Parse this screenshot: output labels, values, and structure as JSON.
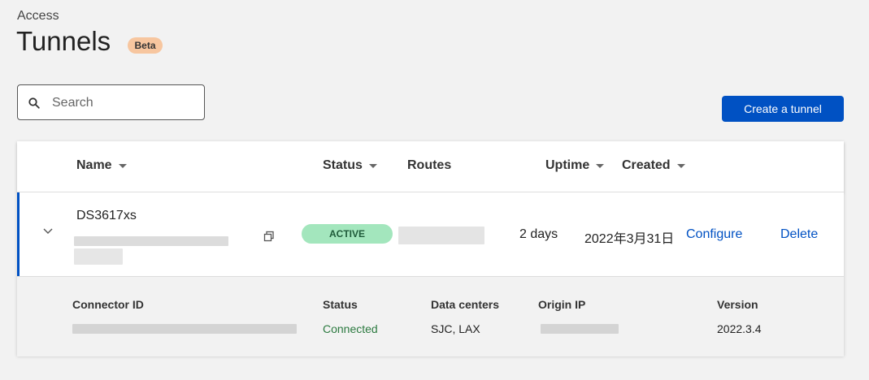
{
  "header": {
    "breadcrumb": "Access",
    "title": "Tunnels",
    "badge": "Beta"
  },
  "search": {
    "placeholder": "Search"
  },
  "actions": {
    "create_label": "Create a tunnel"
  },
  "table": {
    "columns": {
      "name": "Name",
      "status": "Status",
      "routes": "Routes",
      "uptime": "Uptime",
      "created": "Created"
    },
    "rows": [
      {
        "name": "DS3617xs",
        "status": "ACTIVE",
        "uptime": "2 days",
        "created": "2022年3月31日",
        "configure": "Configure",
        "delete": "Delete"
      }
    ]
  },
  "details": {
    "headers": {
      "connector_id": "Connector ID",
      "status": "Status",
      "data_centers": "Data centers",
      "origin_ip": "Origin IP",
      "version": "Version"
    },
    "values": {
      "status": "Connected",
      "data_centers": "SJC, LAX",
      "version": "2022.3.4"
    }
  },
  "colors": {
    "accent": "#0051c3",
    "badge": "#f7c69f",
    "active_pill": "#a3e6bd",
    "connected": "#2c7a40"
  }
}
